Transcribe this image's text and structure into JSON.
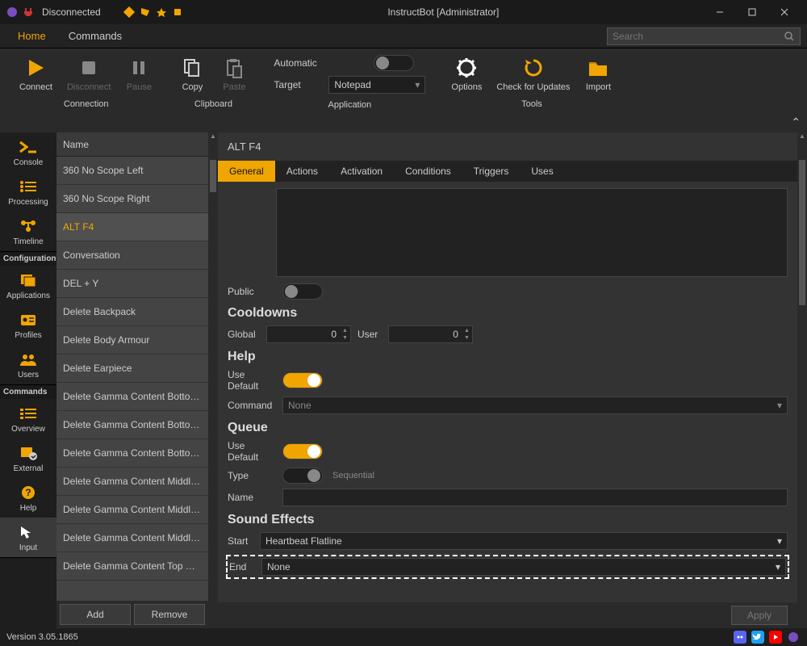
{
  "window": {
    "title": "InstructBot [Administrator]",
    "connection_status": "Disconnected"
  },
  "menubar": {
    "tabs": [
      "Home",
      "Commands"
    ],
    "active_tab": "Home",
    "search_placeholder": "Search"
  },
  "ribbon": {
    "groups": {
      "connection": {
        "label": "Connection",
        "connect": "Connect",
        "disconnect": "Disconnect",
        "pause": "Pause"
      },
      "clipboard": {
        "label": "Clipboard",
        "copy": "Copy",
        "paste": "Paste"
      },
      "application": {
        "label": "Application",
        "automatic": "Automatic",
        "target": "Target",
        "target_value": "Notepad"
      },
      "tools": {
        "label": "Tools",
        "options": "Options",
        "check_updates": "Check for Updates",
        "import": "Import"
      }
    }
  },
  "leftnav": {
    "sections": [
      {
        "title": "",
        "items": [
          {
            "label": "Console",
            "icon": "console"
          },
          {
            "label": "Processing",
            "icon": "processing"
          },
          {
            "label": "Timeline",
            "icon": "timeline"
          }
        ]
      },
      {
        "title": "Configuration",
        "items": [
          {
            "label": "Applications",
            "icon": "apps"
          },
          {
            "label": "Profiles",
            "icon": "profiles"
          },
          {
            "label": "Users",
            "icon": "users"
          }
        ]
      },
      {
        "title": "Commands",
        "items": [
          {
            "label": "Overview",
            "icon": "overview"
          },
          {
            "label": "External",
            "icon": "external"
          },
          {
            "label": "Help",
            "icon": "help"
          },
          {
            "label": "Input",
            "icon": "input",
            "active": true
          }
        ]
      }
    ]
  },
  "cmdlist": {
    "header": "Name",
    "selected": "ALT F4",
    "items": [
      "360 No Scope Left",
      "360 No Scope Right",
      "ALT F4",
      "Conversation",
      "DEL + Y",
      "Delete Backpack",
      "Delete Body Armour",
      "Delete Earpiece",
      "Delete Gamma Content Bottom ...",
      "Delete Gamma Content Bottom L...",
      "Delete Gamma Content Bottom ...",
      "Delete Gamma Content Middle C...",
      "Delete Gamma Content Middle L...",
      "Delete Gamma Content Middle Ri...",
      "Delete Gamma Content Top Cen..."
    ],
    "add": "Add",
    "remove": "Remove"
  },
  "detail": {
    "title": "ALT F4",
    "tabs": [
      "General",
      "Actions",
      "Activation",
      "Conditions",
      "Triggers",
      "Uses"
    ],
    "active_tab": "General",
    "public": "Public",
    "sections": {
      "cooldowns": {
        "title": "Cooldowns",
        "global": "Global",
        "global_value": "0",
        "user": "User",
        "user_value": "0"
      },
      "help": {
        "title": "Help",
        "use_default": "Use Default",
        "command": "Command",
        "command_value": "None"
      },
      "queue": {
        "title": "Queue",
        "use_default": "Use Default",
        "type": "Type",
        "type_hint": "Sequential",
        "name": "Name",
        "name_value": ""
      },
      "sound": {
        "title": "Sound Effects",
        "start": "Start",
        "start_value": "Heartbeat Flatline",
        "end": "End",
        "end_value": "None"
      }
    },
    "apply": "Apply"
  },
  "statusbar": {
    "version": "Version 3.05.1865"
  }
}
